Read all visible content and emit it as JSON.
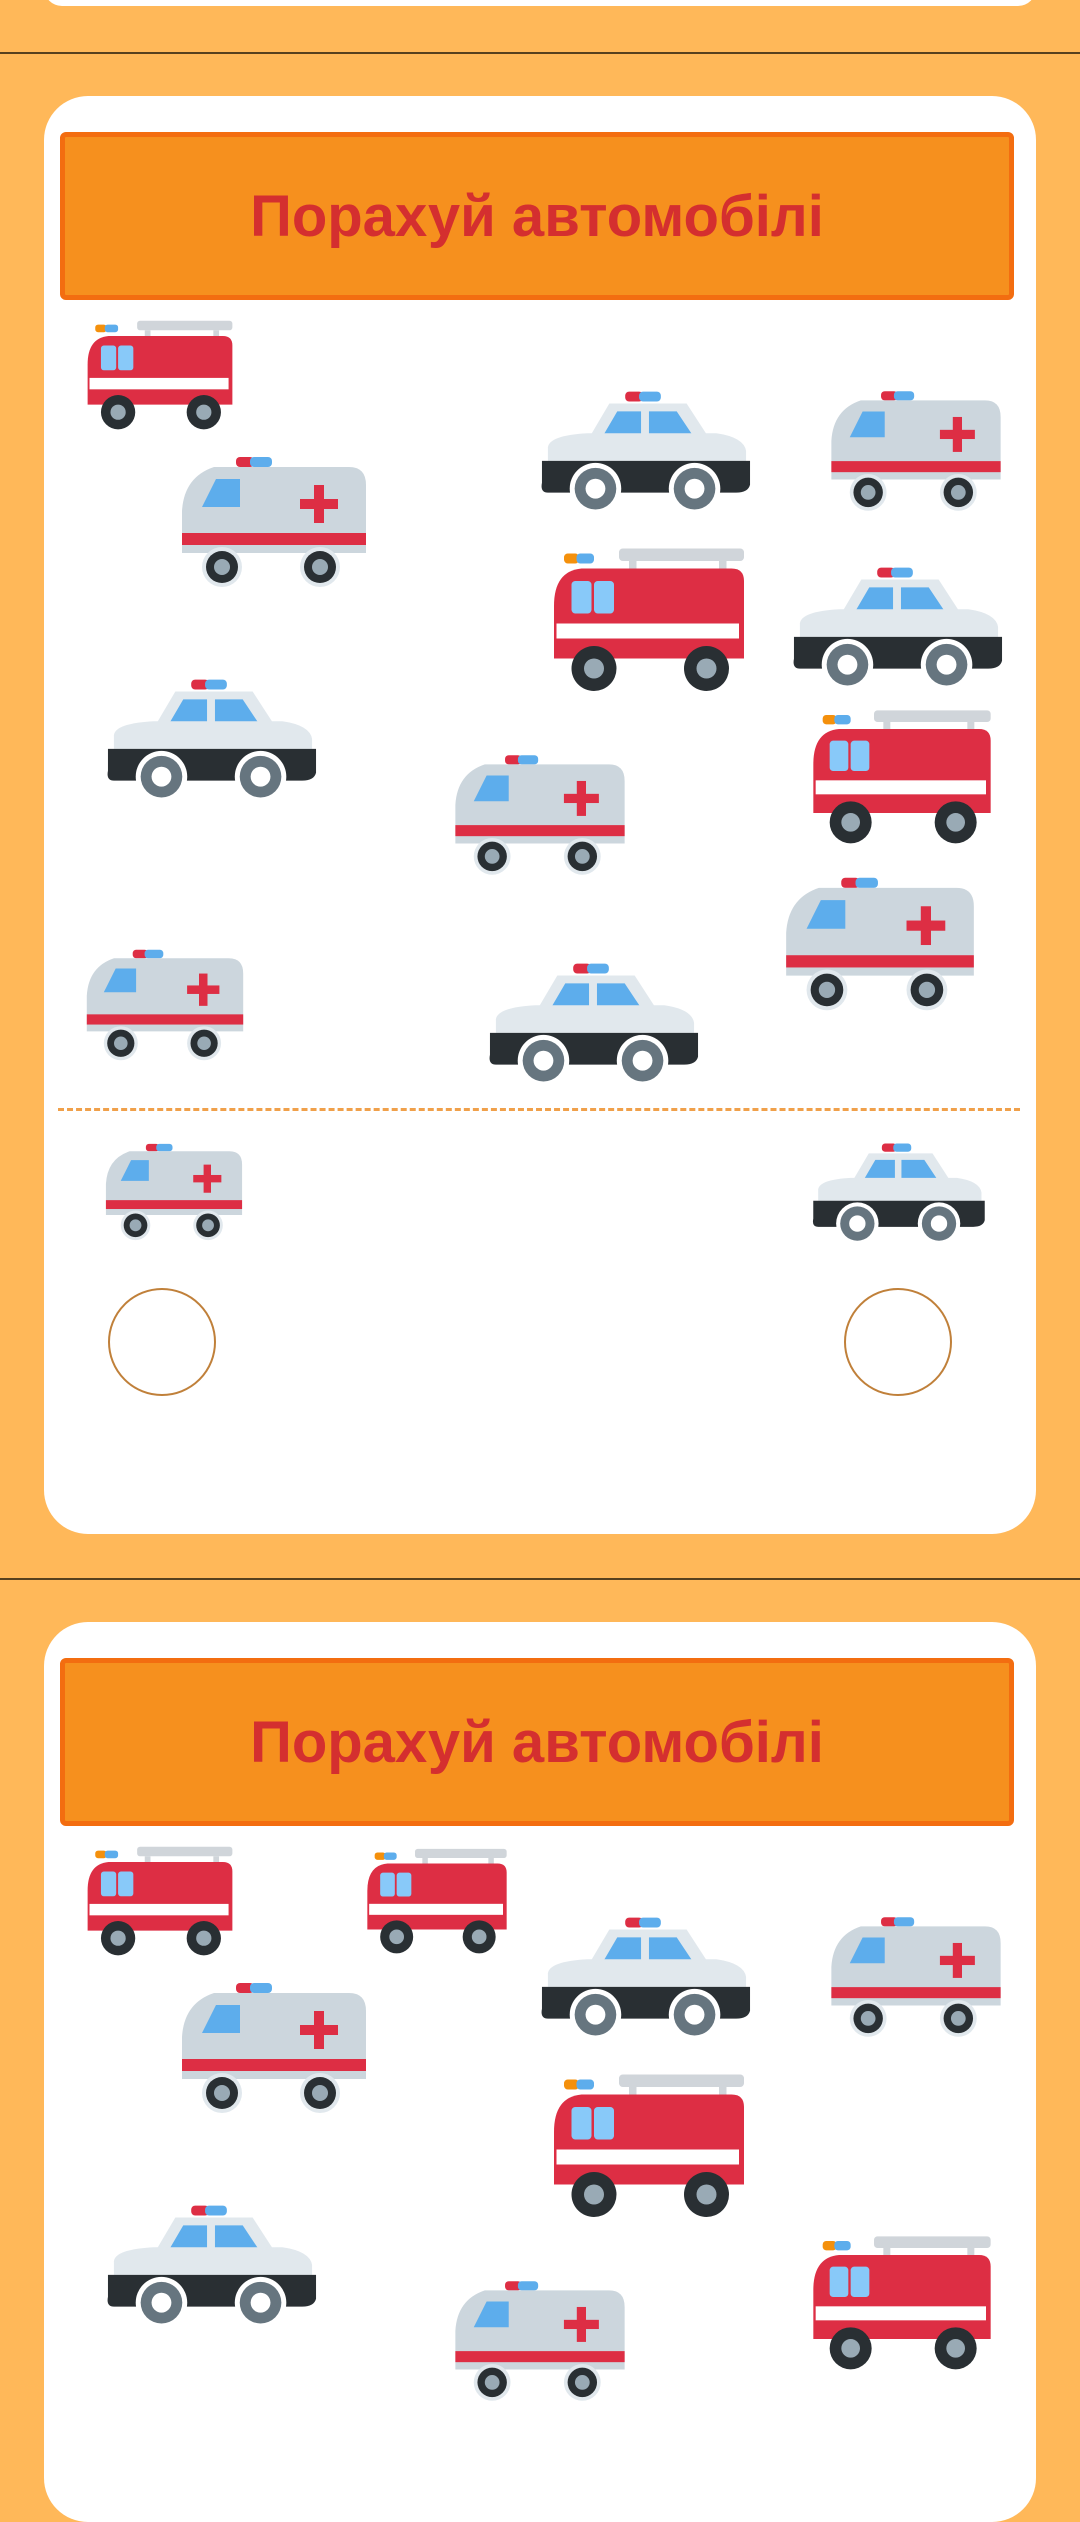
{
  "worksheet": {
    "title": "Порахуй автомобілі",
    "vehicle_types": [
      "fire-truck",
      "ambulance",
      "police-car"
    ],
    "colors": {
      "background": "#ffb859",
      "banner_fill": "#f6901e",
      "banner_border": "#f36d10",
      "title_text": "#d42f2f"
    }
  },
  "pages": [
    {
      "title": "Порахуй автомобілі",
      "vehicles": [
        {
          "type": "fire-truck"
        },
        {
          "type": "ambulance"
        },
        {
          "type": "police-car"
        },
        {
          "type": "police-car"
        },
        {
          "type": "ambulance"
        },
        {
          "type": "ambulance"
        },
        {
          "type": "fire-truck"
        },
        {
          "type": "police-car"
        },
        {
          "type": "fire-truck"
        },
        {
          "type": "ambulance"
        },
        {
          "type": "ambulance"
        },
        {
          "type": "police-car"
        }
      ],
      "answer_items": [
        {
          "type": "ambulance"
        },
        {
          "type": "police-car"
        }
      ]
    },
    {
      "title": "Порахуй автомобілі",
      "vehicles": [
        {
          "type": "fire-truck"
        },
        {
          "type": "fire-truck"
        },
        {
          "type": "police-car"
        },
        {
          "type": "ambulance"
        },
        {
          "type": "ambulance"
        },
        {
          "type": "fire-truck"
        },
        {
          "type": "police-car"
        },
        {
          "type": "ambulance"
        },
        {
          "type": "fire-truck"
        }
      ]
    }
  ]
}
